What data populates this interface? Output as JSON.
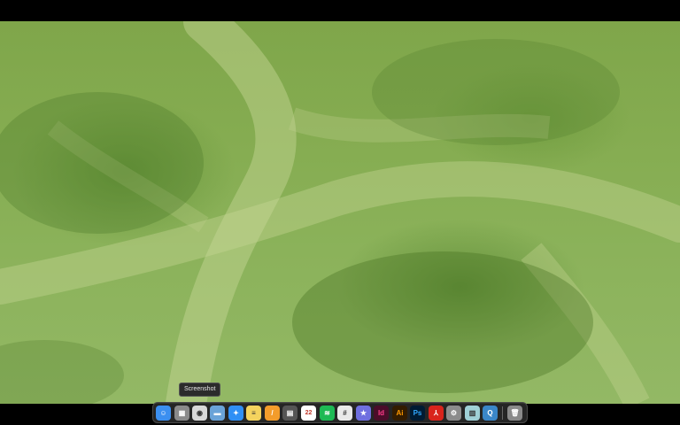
{
  "tooltip": {
    "text": "Screenshot"
  },
  "dock": {
    "items": [
      {
        "name": "finder-icon",
        "glyph": "☺",
        "color": "#3b8ff0"
      },
      {
        "name": "launchpad-icon",
        "glyph": "▦",
        "color": "#8a8a8a"
      },
      {
        "name": "screenshot-icon",
        "glyph": "◉",
        "color": "#d8d8d8"
      },
      {
        "name": "preview-icon",
        "glyph": "▬",
        "color": "#6aa3d8"
      },
      {
        "name": "safari-icon",
        "glyph": "✦",
        "color": "#2f8ff5"
      },
      {
        "name": "notes-icon",
        "glyph": "≡",
        "color": "#f4d35e"
      },
      {
        "name": "pages-icon",
        "glyph": "/",
        "color": "#f39c2b"
      },
      {
        "name": "calculator-icon",
        "glyph": "▤",
        "color": "#555555"
      },
      {
        "name": "calendar-icon",
        "glyph": "22",
        "color": "#ffffff"
      },
      {
        "name": "spotify-icon",
        "glyph": "≋",
        "color": "#1db954"
      },
      {
        "name": "slack-icon",
        "glyph": "#",
        "color": "#e9e9e9"
      },
      {
        "name": "imovie-icon",
        "glyph": "★",
        "color": "#6f6fe0"
      },
      {
        "name": "indesign-icon",
        "glyph": "Id",
        "color": "#4b0d2a"
      },
      {
        "name": "illustrator-icon",
        "glyph": "Ai",
        "color": "#331c00"
      },
      {
        "name": "photoshop-icon",
        "glyph": "Ps",
        "color": "#001b33"
      },
      {
        "name": "acrobat-icon",
        "glyph": "⅄",
        "color": "#d9241c"
      },
      {
        "name": "system-preferences-icon",
        "glyph": "⚙",
        "color": "#8c8c8c"
      },
      {
        "name": "archive-utility-icon",
        "glyph": "▥",
        "color": "#9fd0d6"
      },
      {
        "name": "quicktime-icon",
        "glyph": "Q",
        "color": "#3a86c8"
      },
      {
        "name": "trash-icon",
        "glyph": "🗑",
        "color": "#8a8a8a"
      }
    ]
  }
}
